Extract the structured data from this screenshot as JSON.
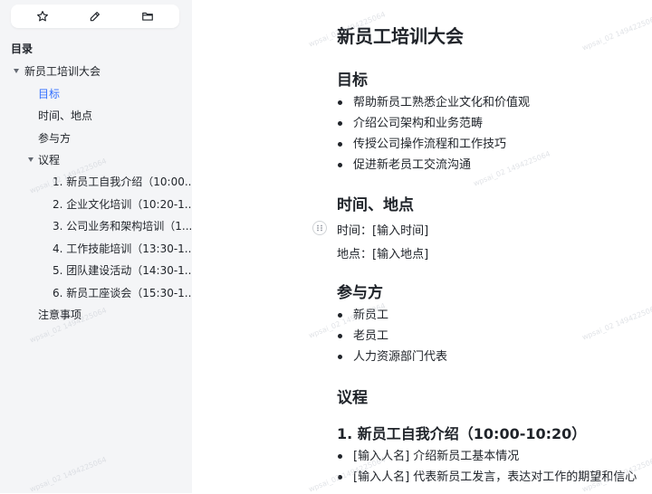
{
  "sidebar": {
    "toolbar": [
      {
        "icon": "star-icon",
        "label": ""
      },
      {
        "icon": "pencil-icon",
        "label": ""
      },
      {
        "icon": "folder-icon",
        "label": ""
      }
    ],
    "toc_title": "目录",
    "items": [
      {
        "label": "新员工培训大会",
        "level": 0,
        "expanded": true
      },
      {
        "label": "目标",
        "level": 1,
        "active": true
      },
      {
        "label": "时间、地点",
        "level": 1
      },
      {
        "label": "参与方",
        "level": 1
      },
      {
        "label": "议程",
        "level": 1,
        "expanded": true
      },
      {
        "label": "1. 新员工自我介绍（10:00...",
        "level": 2
      },
      {
        "label": "2. 企业文化培训（10:20-1...",
        "level": 2
      },
      {
        "label": "3. 公司业务和架构培训（1...",
        "level": 2
      },
      {
        "label": "4. 工作技能培训（13:30-1...",
        "level": 2
      },
      {
        "label": "5. 团队建设活动（14:30-1...",
        "level": 2
      },
      {
        "label": "6. 新员工座谈会（15:30-1...",
        "level": 2
      },
      {
        "label": "注意事项",
        "level": 1
      }
    ]
  },
  "doc": {
    "title": "新员工培训大会",
    "goals": {
      "heading": "目标",
      "items": [
        "帮助新员工熟悉企业文化和价值观",
        "介绍公司架构和业务范畴",
        "传授公司操作流程和工作技巧",
        "促进新老员工交流沟通"
      ]
    },
    "time_place": {
      "heading": "时间、地点",
      "time": "时间：[输入时间]",
      "place": "地点：[输入地点]"
    },
    "participants": {
      "heading": "参与方",
      "items": [
        "新员工",
        "老员工",
        "人力资源部门代表"
      ]
    },
    "agenda": {
      "heading": "议程",
      "sub1": {
        "heading": "1. 新员工自我介绍（10:00-10:20）",
        "items": [
          "[输入人名] 介绍新员工基本情况",
          "[输入人名] 代表新员工发言，表达对工作的期望和信心"
        ]
      }
    }
  },
  "watermark": "wpsai_02 1494225064"
}
